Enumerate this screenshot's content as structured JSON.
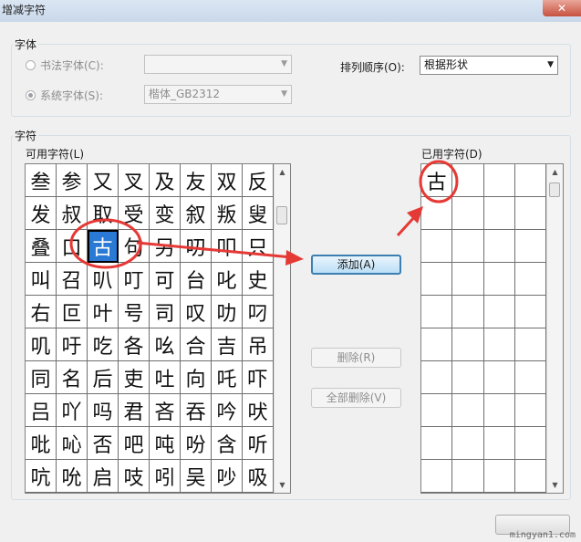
{
  "window": {
    "title": "增减字符",
    "close_glyph": "✕"
  },
  "font_group": {
    "label": "字体",
    "calligraphy_radio": "书法字体(C):",
    "calligraphy_value": "",
    "system_radio": "系统字体(S):",
    "system_value": "楷体_GB2312",
    "sort_label": "排列顺序(O):",
    "sort_value": "根据形状"
  },
  "chars_group": {
    "label": "字符",
    "available_label": "可用字符(L)",
    "used_label": "已用字符(D)",
    "available_chars": [
      [
        "叁",
        "参",
        "又",
        "叉",
        "及",
        "友",
        "双",
        "反"
      ],
      [
        "发",
        "叔",
        "取",
        "受",
        "变",
        "叙",
        "叛",
        "叟"
      ],
      [
        "叠",
        "口",
        "古",
        "句",
        "另",
        "叨",
        "叩",
        "只"
      ],
      [
        "叫",
        "召",
        "叭",
        "叮",
        "可",
        "台",
        "叱",
        "史"
      ],
      [
        "右",
        "叵",
        "叶",
        "号",
        "司",
        "叹",
        "叻",
        "叼"
      ],
      [
        "叽",
        "吁",
        "吃",
        "各",
        "吆",
        "合",
        "吉",
        "吊"
      ],
      [
        "同",
        "名",
        "后",
        "吏",
        "吐",
        "向",
        "吒",
        "吓"
      ],
      [
        "吕",
        "吖",
        "吗",
        "君",
        "吝",
        "吞",
        "吟",
        "吠"
      ],
      [
        "吡",
        "吣",
        "否",
        "吧",
        "吨",
        "吩",
        "含",
        "听"
      ],
      [
        "吭",
        "吮",
        "启",
        "吱",
        "吲",
        "吴",
        "吵",
        "吸"
      ]
    ],
    "selected_char": "古",
    "used_chars": [
      "古"
    ],
    "add_button": "添加(A)",
    "delete_button": "删除(R)",
    "delete_all_button": "全部删除(V)"
  },
  "watermark": "mingyan1.com",
  "colors": {
    "annotation_red": "#e53935",
    "selection_blue": "#2a7ad5"
  }
}
